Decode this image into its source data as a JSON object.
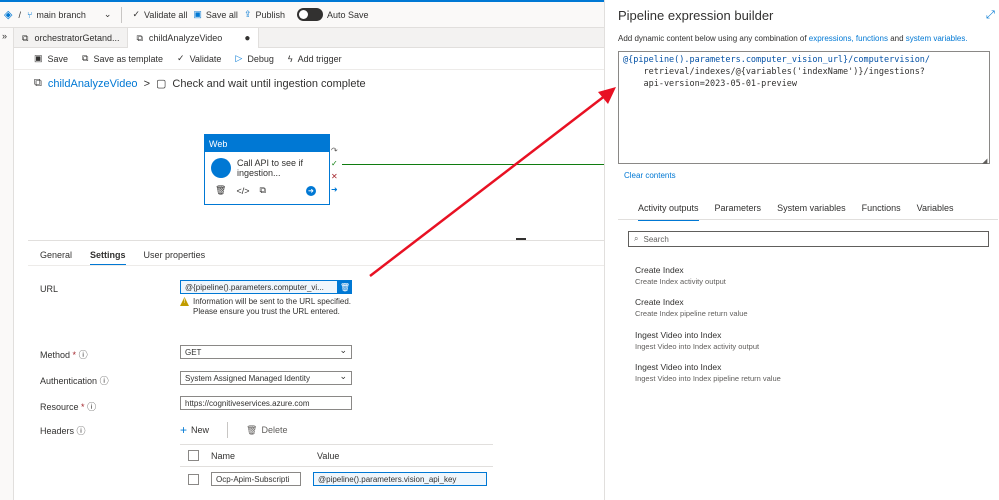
{
  "topbar": {
    "branch": "main branch",
    "validate_all": "Validate all",
    "save_all": "Save all",
    "publish": "Publish",
    "auto_save": "Auto Save",
    "slash": "/"
  },
  "tabs": [
    {
      "label": "orchestratorGetand..."
    },
    {
      "label": "childAnalyzeVideo"
    }
  ],
  "toolbar": {
    "save": "Save",
    "save_as_template": "Save as template",
    "validate": "Validate",
    "debug": "Debug",
    "add_trigger": "Add trigger"
  },
  "breadcrumb": {
    "pipeline": "childAnalyzeVideo",
    "separator": ">",
    "activity": "Check and wait until ingestion complete"
  },
  "activity_card": {
    "type": "Web",
    "label": "Call API to see if ingestion..."
  },
  "bottom_tabs": [
    "General",
    "Settings",
    "User properties"
  ],
  "settings": {
    "url_label": "URL",
    "url_value": "@{pipeline().parameters.computer_vi...",
    "warning": "Information will be sent to the URL specified. Please ensure you trust the URL entered.",
    "method_label": "Method",
    "method_value": "GET",
    "auth_label": "Authentication",
    "auth_value": "System Assigned Managed Identity",
    "resource_label": "Resource",
    "resource_value": "https://cognitiveservices.azure.com",
    "headers_label": "Headers",
    "new_label": "New",
    "delete_label": "Delete",
    "col_name": "Name",
    "col_value": "Value",
    "header_name": "Ocp-Apim-Subscripti",
    "header_value": "@pipeline().parameters.vision_api_key",
    "required_mark": "*",
    "info_mark": "ⓘ"
  },
  "panel": {
    "title": "Pipeline expression builder",
    "subtitle_prefix": "Add dynamic content below using any combination of",
    "link_expressions": "expressions, functions",
    "and": "and",
    "link_system": "system variables.",
    "expression_line1": "@{pipeline().parameters.computer_vision_url}/computervision/",
    "expression_line2": "    retrieval/indexes/@{variables('indexName')}/ingestions?",
    "expression_line3": "    api-version=2023-05-01-preview",
    "clear_contents": "Clear contents",
    "tabs": [
      "Activity outputs",
      "Parameters",
      "System variables",
      "Functions",
      "Variables"
    ],
    "search_placeholder": "Search",
    "items": [
      {
        "title": "Create Index",
        "sub": "Create Index activity output"
      },
      {
        "title": "Create Index",
        "sub": "Create Index pipeline return value"
      },
      {
        "title": "Ingest Video into Index",
        "sub": "Ingest Video into Index activity output"
      },
      {
        "title": "Ingest Video into Index",
        "sub": "Ingest Video into Index pipeline return value"
      }
    ]
  },
  "colors": {
    "accent": "#0078d4",
    "arrow": "#e81123",
    "success": "#107c10",
    "error": "#a4262c"
  }
}
